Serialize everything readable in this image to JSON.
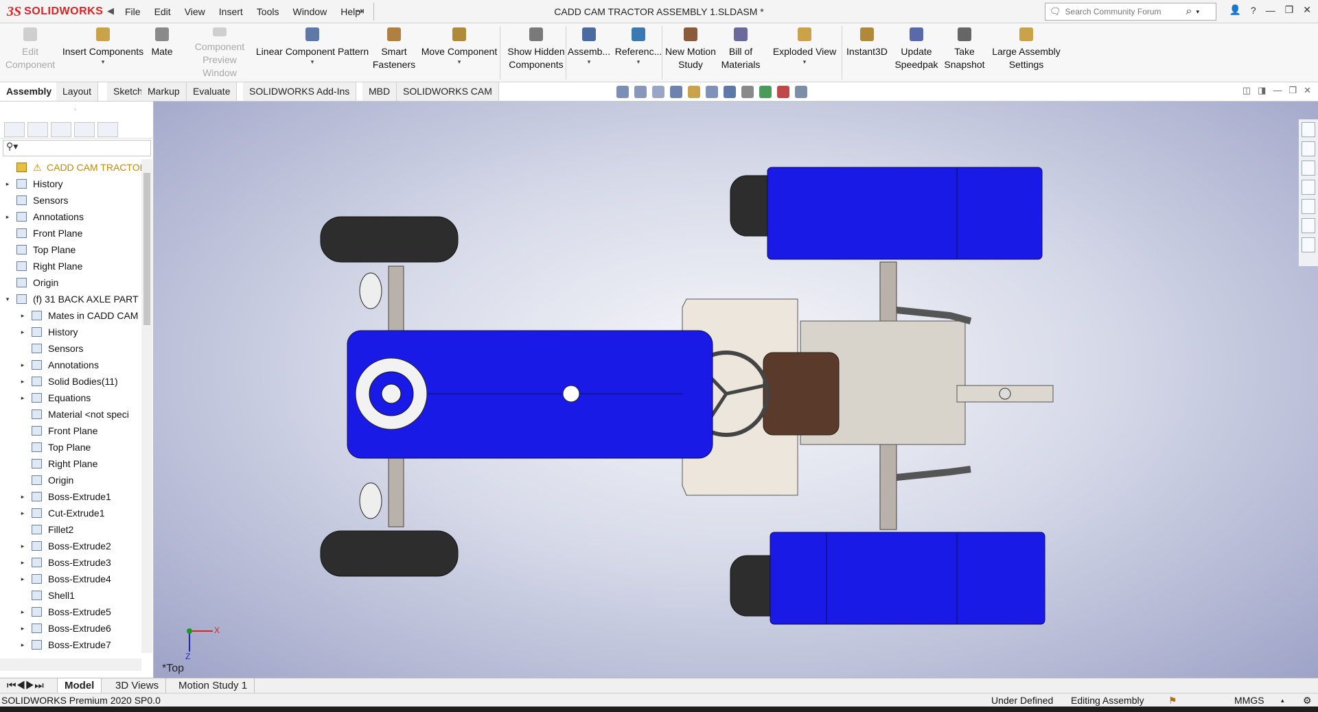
{
  "app": {
    "brand_ds": "3S",
    "brand_name": "SOLIDWORKS",
    "document_title": "CADD CAM TRACTOR ASSEMBLY 1.SLDASM *"
  },
  "menu": [
    "File",
    "Edit",
    "View",
    "Insert",
    "Tools",
    "Window",
    "Help"
  ],
  "search": {
    "placeholder": "Search Community Forum"
  },
  "ribbon": [
    {
      "label_1": "Edit",
      "label_2": "Component",
      "disabled": true
    },
    {
      "label_1": "Insert Components",
      "label_2": "",
      "disabled": false
    },
    {
      "label_1": "Mate",
      "label_2": "",
      "disabled": false
    },
    {
      "label_1": "Component",
      "label_2": "Preview Window",
      "disabled": true
    },
    {
      "label_1": "Linear Component Pattern",
      "label_2": "",
      "disabled": false
    },
    {
      "label_1": "Smart",
      "label_2": "Fasteners",
      "disabled": false
    },
    {
      "label_1": "Move Component",
      "label_2": "",
      "disabled": false
    },
    {
      "label_1": "Show Hidden",
      "label_2": "Components",
      "disabled": false
    },
    {
      "label_1": "Assemb...",
      "label_2": "",
      "disabled": false
    },
    {
      "label_1": "Referenc...",
      "label_2": "",
      "disabled": false
    },
    {
      "label_1": "New Motion",
      "label_2": "Study",
      "disabled": false
    },
    {
      "label_1": "Bill of",
      "label_2": "Materials",
      "disabled": false
    },
    {
      "label_1": "Exploded View",
      "label_2": "",
      "disabled": false
    },
    {
      "label_1": "Instant3D",
      "label_2": "",
      "disabled": false
    },
    {
      "label_1": "Update",
      "label_2": "Speedpak",
      "disabled": false
    },
    {
      "label_1": "Take",
      "label_2": "Snapshot",
      "disabled": false
    },
    {
      "label_1": "Large Assembly",
      "label_2": "Settings",
      "disabled": false
    }
  ],
  "command_tabs": [
    "Assembly",
    "Layout",
    "Sketch",
    "Markup",
    "Evaluate",
    "SOLIDWORKS Add-Ins",
    "MBD",
    "SOLIDWORKS CAM"
  ],
  "tree": [
    {
      "label": "CADD CAM TRACTOR A",
      "level": 0,
      "arrow": "",
      "warn": true
    },
    {
      "label": "History",
      "level": 0,
      "arrow": "▸"
    },
    {
      "label": "Sensors",
      "level": 0,
      "arrow": ""
    },
    {
      "label": "Annotations",
      "level": 0,
      "arrow": "▸"
    },
    {
      "label": "Front Plane",
      "level": 0,
      "arrow": ""
    },
    {
      "label": "Top Plane",
      "level": 0,
      "arrow": ""
    },
    {
      "label": "Right Plane",
      "level": 0,
      "arrow": ""
    },
    {
      "label": "Origin",
      "level": 0,
      "arrow": ""
    },
    {
      "label": "(f) 31 BACK AXLE PART",
      "level": 0,
      "arrow": "▾"
    },
    {
      "label": "Mates in CADD CAM",
      "level": 1,
      "arrow": "▸"
    },
    {
      "label": "History",
      "level": 1,
      "arrow": "▸"
    },
    {
      "label": "Sensors",
      "level": 1,
      "arrow": ""
    },
    {
      "label": "Annotations",
      "level": 1,
      "arrow": "▸"
    },
    {
      "label": "Solid Bodies(11)",
      "level": 1,
      "arrow": "▸"
    },
    {
      "label": "Equations",
      "level": 1,
      "arrow": "▸"
    },
    {
      "label": "Material <not speci",
      "level": 1,
      "arrow": ""
    },
    {
      "label": "Front Plane",
      "level": 1,
      "arrow": ""
    },
    {
      "label": "Top Plane",
      "level": 1,
      "arrow": ""
    },
    {
      "label": "Right Plane",
      "level": 1,
      "arrow": ""
    },
    {
      "label": "Origin",
      "level": 1,
      "arrow": ""
    },
    {
      "label": "Boss-Extrude1",
      "level": 1,
      "arrow": "▸"
    },
    {
      "label": "Cut-Extrude1",
      "level": 1,
      "arrow": "▸"
    },
    {
      "label": "Fillet2",
      "level": 1,
      "arrow": ""
    },
    {
      "label": "Boss-Extrude2",
      "level": 1,
      "arrow": "▸"
    },
    {
      "label": "Boss-Extrude3",
      "level": 1,
      "arrow": "▸"
    },
    {
      "label": "Boss-Extrude4",
      "level": 1,
      "arrow": "▸"
    },
    {
      "label": "Shell1",
      "level": 1,
      "arrow": ""
    },
    {
      "label": "Boss-Extrude5",
      "level": 1,
      "arrow": "▸"
    },
    {
      "label": "Boss-Extrude6",
      "level": 1,
      "arrow": "▸"
    },
    {
      "label": "Boss-Extrude7",
      "level": 1,
      "arrow": "▸"
    }
  ],
  "viewport": {
    "view_name": "*Top",
    "axis_x": "X",
    "axis_z": "Z"
  },
  "bottom_tabs": [
    "Model",
    "3D Views",
    "Motion Study 1"
  ],
  "status": {
    "product": "SOLIDWORKS Premium 2020 SP0.0",
    "state": "Under Defined",
    "mode": "Editing Assembly",
    "units": "MMGS"
  },
  "colors": {
    "body_blue": "#1a1ae6",
    "tire_dark": "#2a2a2a",
    "seat_brown": "#5a3a2a",
    "plate_cream": "#ece6dc",
    "brand_red": "#dd2222"
  }
}
